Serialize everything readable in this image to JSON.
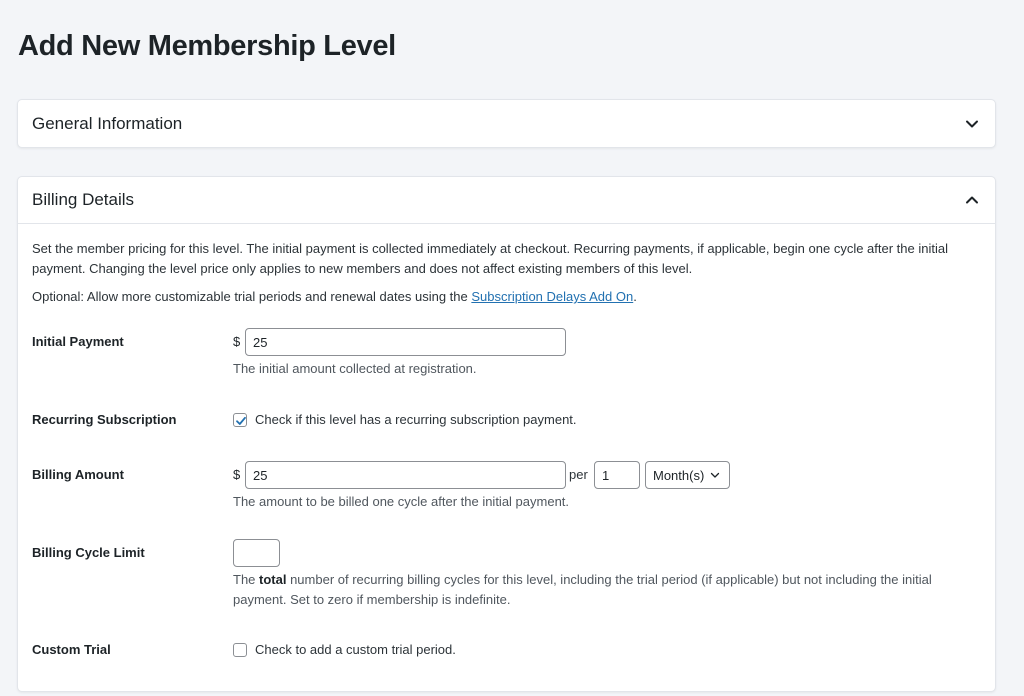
{
  "page": {
    "title": "Add New Membership Level"
  },
  "panels": {
    "general": {
      "title": "General Information",
      "state": "collapsed",
      "toggle_icon": "chevron-down-icon"
    },
    "billing": {
      "title": "Billing Details",
      "state": "expanded",
      "toggle_icon": "chevron-up-icon",
      "intro_text": "Set the member pricing for this level. The initial payment is collected immediately at checkout. Recurring payments, if applicable, begin one cycle after the initial payment. Changing the level price only applies to new members and does not affect existing members of this level.",
      "optional_prefix": "Optional: Allow more customizable trial periods and renewal dates using the ",
      "optional_link": "Subscription Delays Add On",
      "optional_suffix": ".",
      "link_color": "#2271b1",
      "fields": {
        "initial_payment": {
          "label": "Initial Payment",
          "currency": "$",
          "value": "25",
          "description": "The initial amount collected at registration."
        },
        "recurring": {
          "label": "Recurring Subscription",
          "checked": true,
          "checkbox_label": "Check if this level has a recurring subscription payment."
        },
        "billing_amount": {
          "label": "Billing Amount",
          "currency": "$",
          "value": "25",
          "per_label": "per",
          "period_number": "1",
          "period_unit": "Month(s)",
          "description": "The amount to be billed one cycle after the initial payment."
        },
        "billing_cycle_limit": {
          "label": "Billing Cycle Limit",
          "value": "",
          "description_prefix": "The ",
          "description_bold": "total",
          "description_suffix": " number of recurring billing cycles for this level, including the trial period (if applicable) but not including the initial payment. Set to zero if membership is indefinite."
        },
        "custom_trial": {
          "label": "Custom Trial",
          "checked": false,
          "checkbox_label": "Check to add a custom trial period."
        }
      }
    }
  }
}
